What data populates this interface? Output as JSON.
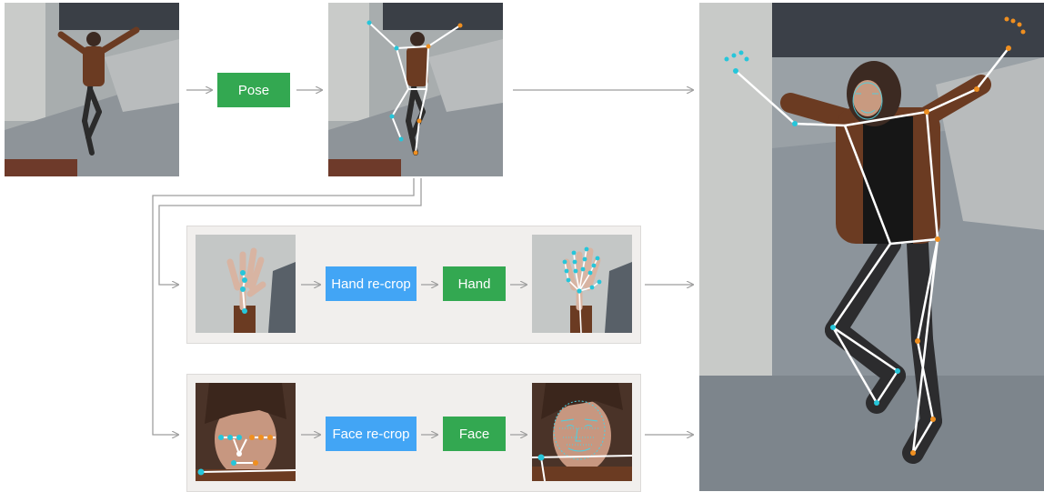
{
  "steps": {
    "pose": "Pose",
    "hand_recrop": "Hand re-crop",
    "hand": "Hand",
    "face_recrop": "Face re-crop",
    "face": "Face"
  },
  "colors": {
    "model_box": "#33a851",
    "crop_box": "#42a5f5",
    "arrow": "#9e9e9e",
    "skeleton_line": "#ffffff",
    "joint_left": "#26c6da",
    "joint_right": "#ef8f20",
    "panel_bg": "#f1efed"
  },
  "icons": {
    "input_image": "dancing-person-photo",
    "pose_output": "pose-skeleton-photo",
    "hand_crop": "hand-crop-photo",
    "hand_output": "hand-landmarks-photo",
    "face_crop": "face-crop-photo",
    "face_output": "face-mesh-photo",
    "final_output": "holistic-landmarks-photo"
  }
}
